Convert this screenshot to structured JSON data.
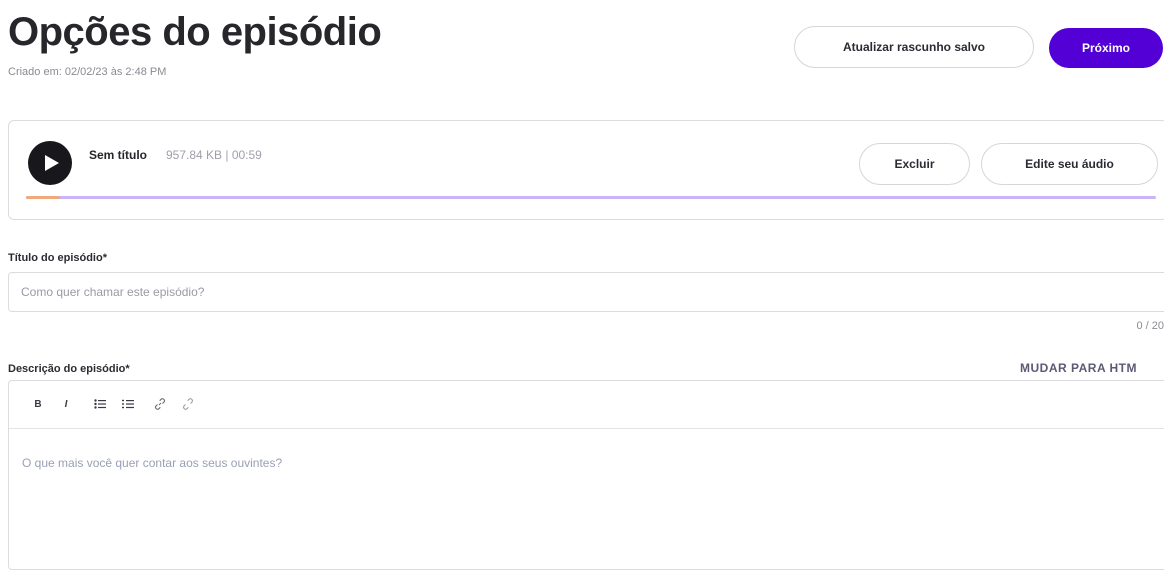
{
  "header": {
    "title": "Opções do episódio",
    "created": "Criado em: 02/02/23 às 2:48 PM",
    "save_draft_label": "Atualizar rascunho salvo",
    "next_label": "Próximo"
  },
  "audio": {
    "title": "Sem título",
    "meta": "957.84 KB | 00:59",
    "delete_label": "Excluir",
    "edit_label": "Edite seu áudio",
    "progress_fraction": 0.03
  },
  "episode_title": {
    "label": "Título do episódio*",
    "placeholder": "Como quer chamar este episódio?",
    "counter": "0 / 20"
  },
  "episode_description": {
    "label": "Descrição do episódio*",
    "switch_html_label": "MUDAR PARA HTM",
    "placeholder": "O que mais você quer contar aos seus ouvintes?",
    "toolbar": {
      "bold": "B",
      "italic": "I",
      "icons": [
        "bulleted-list-icon",
        "numbered-list-icon",
        "link-icon",
        "unlink-icon"
      ]
    }
  },
  "colors": {
    "primary": "#5200d6",
    "progress_track": "#c9b4f5",
    "progress_fill": "#f0a97a"
  }
}
